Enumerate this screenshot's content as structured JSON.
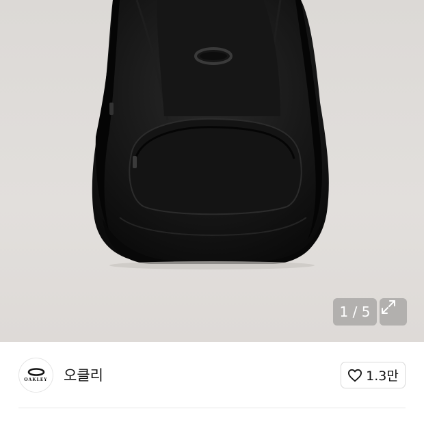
{
  "gallery": {
    "counter_text": "1 / 5",
    "expand_icon": "expand-icon",
    "product_icon": "backpack-icon"
  },
  "brand": {
    "logo_text": "OAKLEY",
    "name": "오클리"
  },
  "like": {
    "icon": "heart-outline-icon",
    "count": "1.3만"
  },
  "colors": {
    "backdrop": "#dedad7",
    "product": "#111111",
    "overlay": "rgba(140,140,140,0.55)"
  }
}
